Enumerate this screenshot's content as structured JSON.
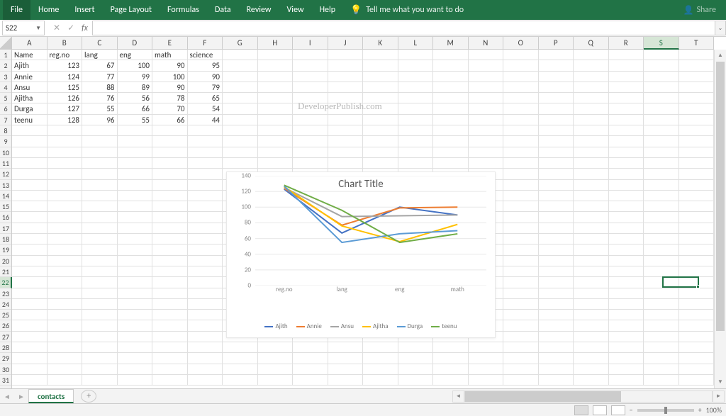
{
  "ribbon": {
    "tabs": [
      "File",
      "Home",
      "Insert",
      "Page Layout",
      "Formulas",
      "Data",
      "Review",
      "View",
      "Help"
    ],
    "tellme": "Tell me what you want to do",
    "share": "Share"
  },
  "namebox": "S22",
  "watermark": "DeveloperPublish.com",
  "columns": [
    "A",
    "B",
    "C",
    "D",
    "E",
    "F",
    "G",
    "H",
    "I",
    "J",
    "K",
    "L",
    "M",
    "N",
    "O",
    "P",
    "Q",
    "R",
    "S",
    "T"
  ],
  "rows_count": 31,
  "selected_col": "S",
  "selected_row": 22,
  "table": {
    "headers": [
      "Name",
      "reg.no",
      "lang",
      "eng",
      "math",
      "science"
    ],
    "rows": [
      [
        "Ajith",
        123,
        67,
        100,
        90,
        95
      ],
      [
        "Annie",
        124,
        77,
        99,
        100,
        90
      ],
      [
        "Ansu",
        125,
        88,
        89,
        90,
        79
      ],
      [
        "Ajitha",
        126,
        76,
        56,
        78,
        65
      ],
      [
        "Durga",
        127,
        55,
        66,
        70,
        54
      ],
      [
        "teenu",
        128,
        96,
        55,
        66,
        44
      ]
    ]
  },
  "chart_data": {
    "type": "line",
    "title": "Chart Title",
    "categories": [
      "reg.no",
      "lang",
      "eng",
      "math"
    ],
    "series": [
      {
        "name": "Ajith",
        "color": "#4472C4",
        "values": [
          123,
          67,
          100,
          90
        ]
      },
      {
        "name": "Annie",
        "color": "#ED7D31",
        "values": [
          124,
          77,
          99,
          100
        ]
      },
      {
        "name": "Ansu",
        "color": "#A5A5A5",
        "values": [
          125,
          88,
          89,
          90
        ]
      },
      {
        "name": "Ajitha",
        "color": "#FFC000",
        "values": [
          126,
          76,
          56,
          78
        ]
      },
      {
        "name": "Durga",
        "color": "#5B9BD5",
        "values": [
          127,
          55,
          66,
          70
        ]
      },
      {
        "name": "teenu",
        "color": "#70AD47",
        "values": [
          128,
          96,
          55,
          66
        ]
      }
    ],
    "ylim": [
      0,
      140
    ],
    "yticks": [
      0,
      20,
      40,
      60,
      80,
      100,
      120,
      140
    ]
  },
  "sheet_tab": "contacts",
  "zoom": "100%"
}
